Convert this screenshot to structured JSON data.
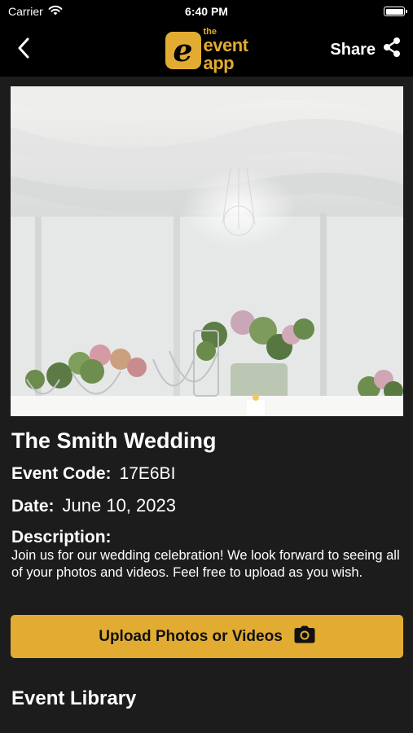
{
  "status_bar": {
    "carrier": "Carrier",
    "time": "6:40 PM"
  },
  "header": {
    "logo_the": "the",
    "logo_event": "event",
    "logo_app": "app",
    "share_label": "Share"
  },
  "event": {
    "title": "The Smith Wedding",
    "code_label": "Event Code:",
    "code_value": "17E6BI",
    "date_label": "Date:",
    "date_value": "June 10, 2023",
    "description_label": "Description:",
    "description": "Join us for our wedding celebration! We look forward to seeing all of your photos and videos. Feel free to upload as you wish."
  },
  "actions": {
    "upload_label": "Upload Photos or Videos"
  },
  "library": {
    "title": "Event Library"
  },
  "colors": {
    "accent": "#e2ac32",
    "background": "#1c1c1c",
    "bar": "#000000"
  },
  "icons": [
    "wifi-icon",
    "battery-icon",
    "back-chevron-icon",
    "share-icon",
    "camera-icon"
  ]
}
